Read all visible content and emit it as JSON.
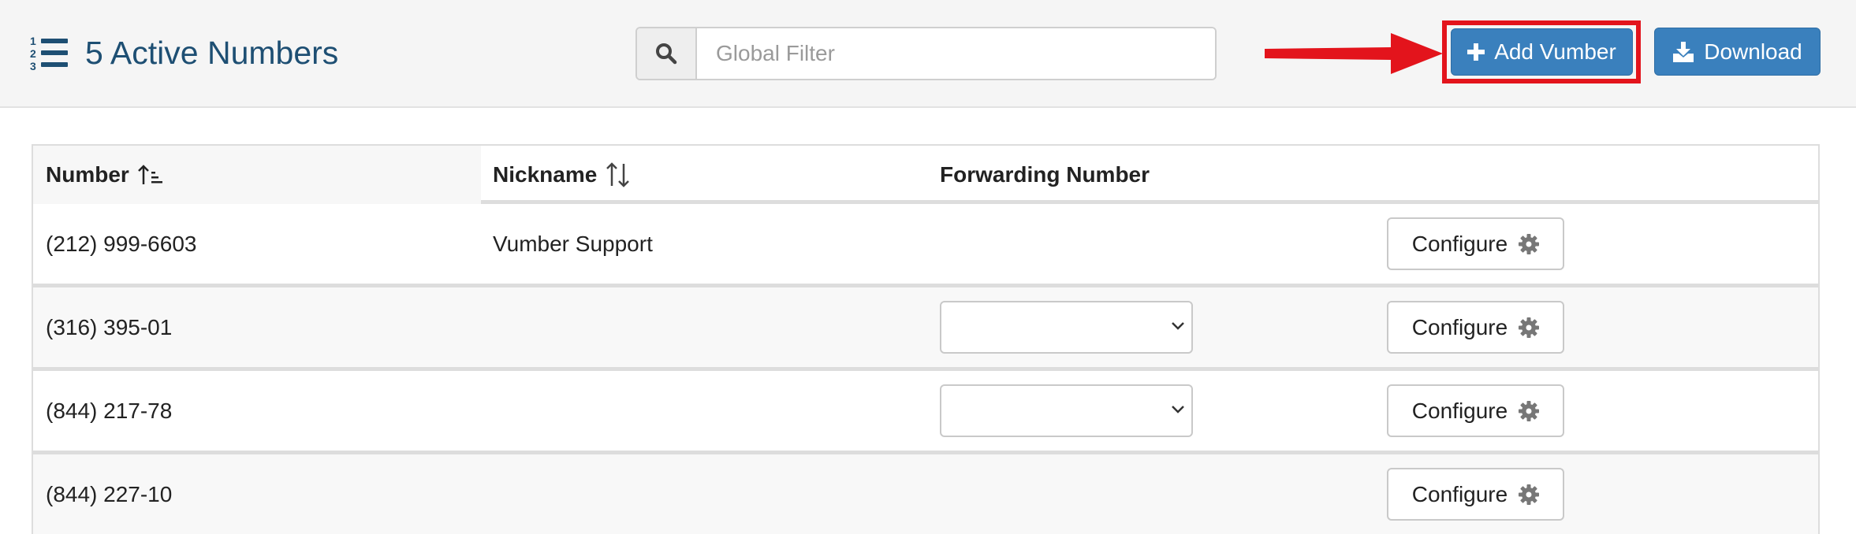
{
  "header": {
    "title": "5 Active Numbers",
    "title_icon": "ordered-list-icon",
    "filter": {
      "placeholder": "Global Filter",
      "value": "",
      "icon": "search-icon"
    },
    "add_button": {
      "label": "Add Vumber",
      "icon": "plus-icon"
    },
    "download_button": {
      "label": "Download",
      "icon": "download-icon"
    },
    "highlight_color": "#e3141c",
    "primary_color": "#3a80bd"
  },
  "table": {
    "columns": [
      {
        "label": "Number",
        "sort": "ascending"
      },
      {
        "label": "Nickname",
        "sort": "unsorted"
      },
      {
        "label": "Forwarding Number",
        "sort": "none"
      },
      {
        "label": "",
        "sort": "none"
      }
    ],
    "rows": [
      {
        "number": "(212) 999-6603",
        "nickname": "Vumber Support",
        "forwarding": null,
        "action": "Configure"
      },
      {
        "number": "(316) 395-01",
        "nickname": "",
        "forwarding": "",
        "action": "Configure"
      },
      {
        "number": "(844) 217-78",
        "nickname": "",
        "forwarding": "",
        "action": "Configure"
      },
      {
        "number": "(844) 227-10",
        "nickname": "",
        "forwarding": null,
        "action": "Configure"
      }
    ],
    "action_icon": "gear-icon"
  }
}
